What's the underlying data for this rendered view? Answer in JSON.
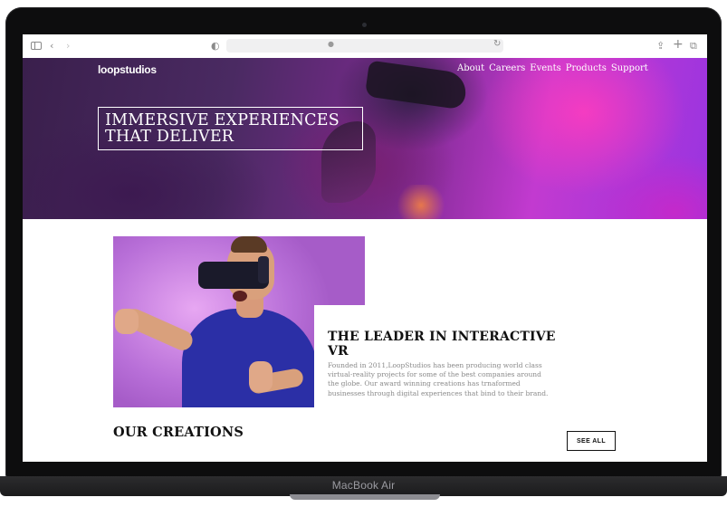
{
  "device": {
    "model_label": "MacBook Air"
  },
  "browser": {
    "icons": {
      "sidebar": "sidebar-toggle-icon",
      "back": "chevron-left-icon",
      "forward": "chevron-right-icon",
      "privacy": "shield-icon",
      "lock": "lock-icon",
      "reload": "reload-icon",
      "share": "share-icon",
      "new_tab": "plus-icon",
      "tabs": "tabs-overview-icon"
    },
    "glyphs": {
      "back": "‹",
      "forward": "›",
      "shield": "◐",
      "lock": "🔒",
      "reload": "↻",
      "share": "⇪",
      "plus": "+",
      "tabs": "⧉"
    }
  },
  "header": {
    "logo": "loopstudios",
    "nav": [
      "About",
      "Careers",
      "Events",
      "Products",
      "Support"
    ]
  },
  "hero": {
    "title_line1": "IMMERSIVE EXPERIENCES",
    "title_line2": "THAT DELIVER"
  },
  "intro": {
    "heading": "THE LEADER IN INTERACTIVE VR",
    "body": "Founded in 2011,LoopStudios has been producing world class virtual-reality projects for some of the best companies around the globe. Our award winning creations has trnaformed businesses through digital experiences that bind to their brand."
  },
  "creations": {
    "heading": "OUR CREATIONS",
    "see_all": "SEE ALL"
  },
  "colors": {
    "hero_purple": "#7a2a8e",
    "hero_pink": "#ff3cbe",
    "shirt_blue": "#2b2fa6",
    "image_lilac": "#b86fd8",
    "body_gray": "#8a8a8a",
    "text_dark": "#111111"
  }
}
